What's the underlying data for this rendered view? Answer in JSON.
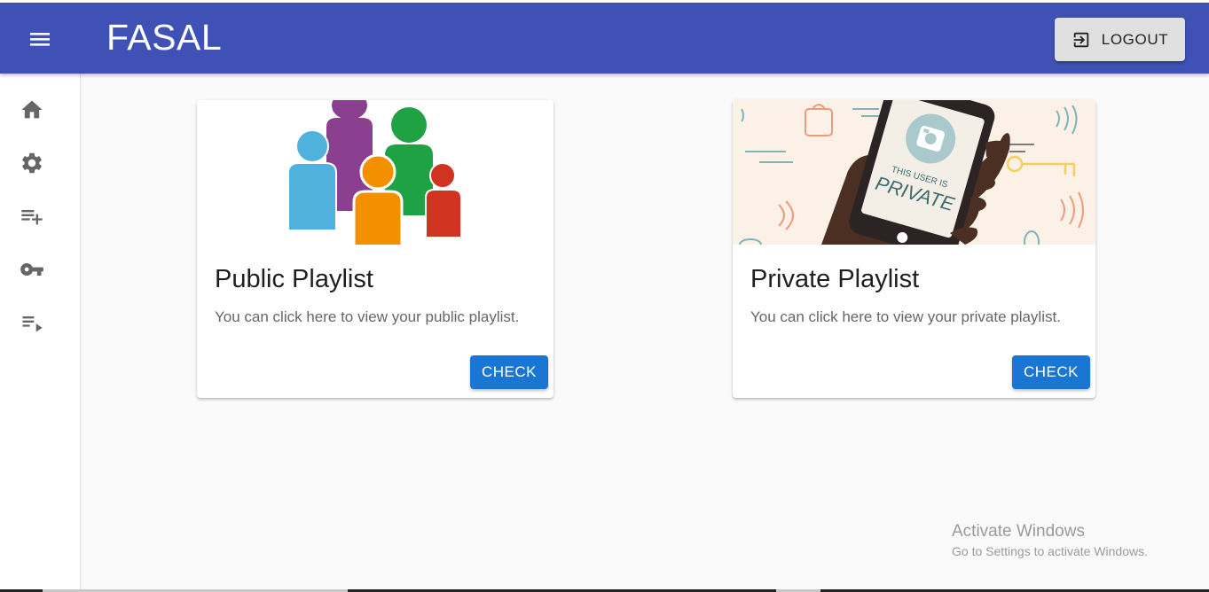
{
  "app": {
    "title": "FASAL",
    "logout_label": "LOGOUT"
  },
  "drawer": {
    "items": [
      {
        "icon": "home-icon"
      },
      {
        "icon": "gear-icon"
      },
      {
        "icon": "playlist-add-icon"
      },
      {
        "icon": "key-icon"
      },
      {
        "icon": "playlist-play-icon"
      }
    ]
  },
  "cards": [
    {
      "title": "Public Playlist",
      "text": "You can click here to view your public playlist.",
      "button": "CHECK"
    },
    {
      "title": "Private Playlist",
      "text": "You can click here to view your private playlist.",
      "button": "CHECK",
      "image_text_1": "THIS USER IS",
      "image_text_2": "PRIVATE"
    }
  ],
  "watermark": {
    "title": "Activate Windows",
    "subtitle": "Go to Settings to activate Windows."
  },
  "colors": {
    "appbar": "#3f51b5",
    "primary_button": "#1976d2",
    "logout_button": "#e0e0e0"
  }
}
